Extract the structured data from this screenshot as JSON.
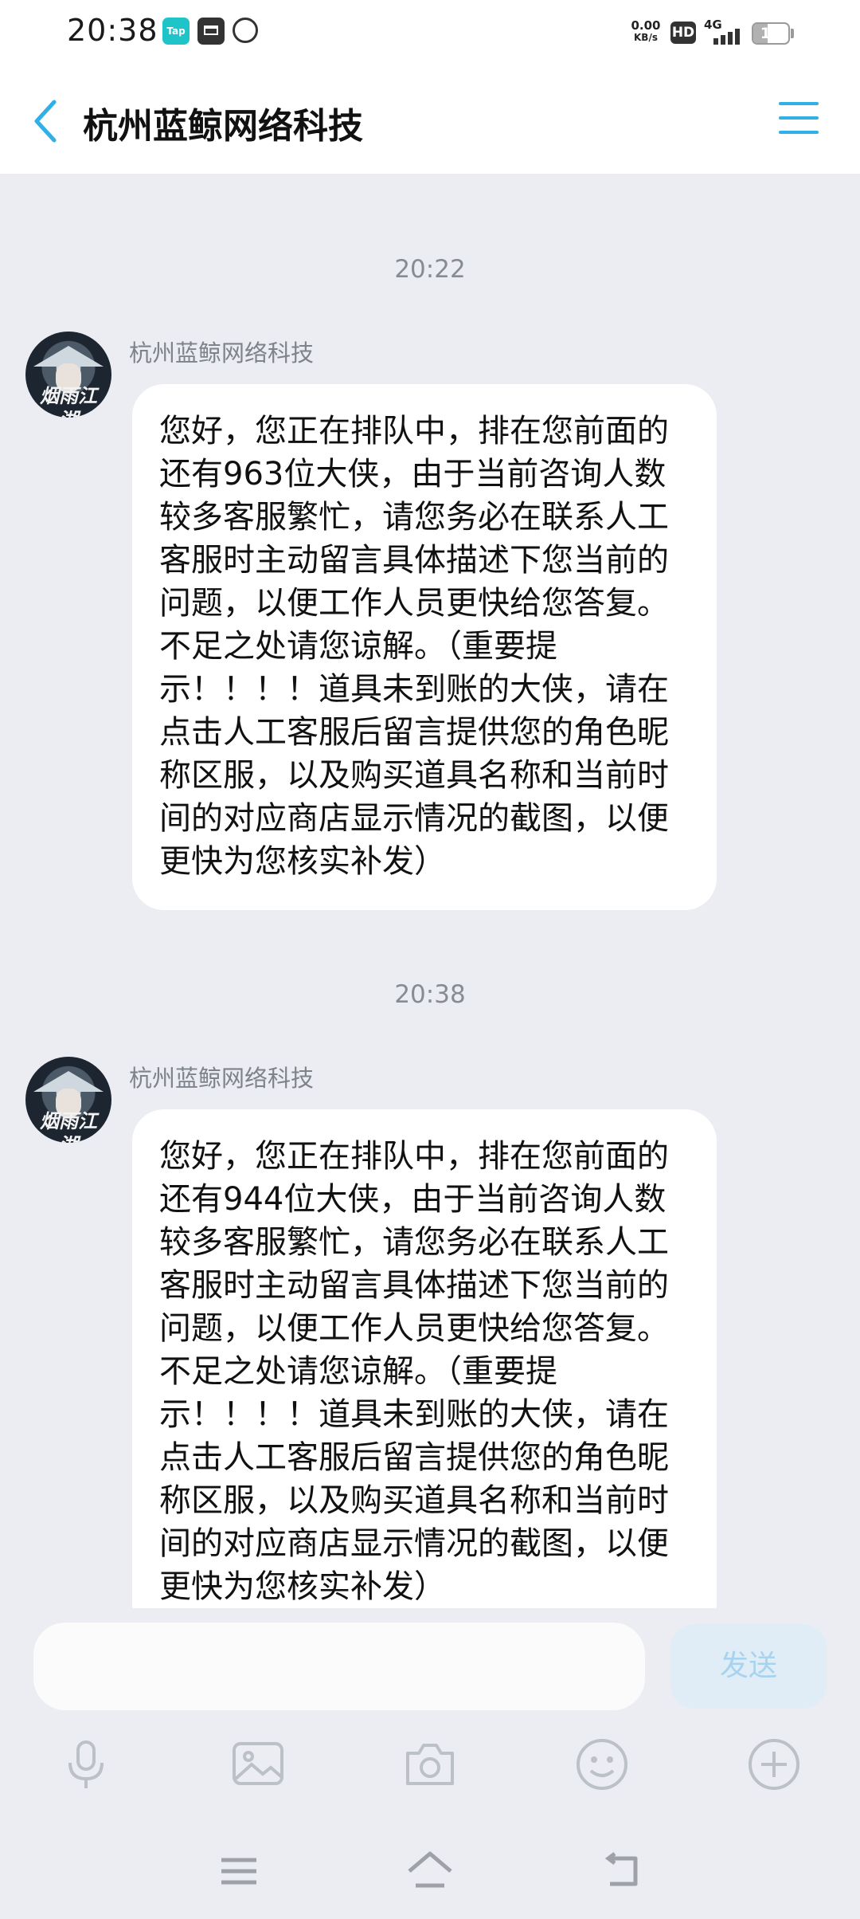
{
  "status_bar": {
    "time": "20:38",
    "app_icon_label": "Tap",
    "net_speed_value": "0.00",
    "net_speed_unit": "KB/s",
    "hd_label": "HD",
    "network": "4G",
    "battery_level": "10"
  },
  "header": {
    "title": "杭州蓝鲸网络科技",
    "back_icon": "chevron-left-icon",
    "menu_icon": "hamburger-menu-icon",
    "accent_color": "#2fb1e8"
  },
  "chat": {
    "messages": [
      {
        "timestamp": "20:22",
        "sender": "杭州蓝鲸网络科技",
        "avatar_text": "烟雨江湖",
        "text": "您好，您正在排队中，排在您前面的还有963位大侠，由于当前咨询人数较多客服繁忙，请您务必在联系人工客服时主动留言具体描述下您当前的问题，以便工作人员更快给您答复。不足之处请您谅解。（重要提示！！！！道具未到账的大侠，请在点击人工客服后留言提供您的角色昵称区服，以及购买道具名称和当前时间的对应商店显示情况的截图，以便更快为您核实补发）"
      },
      {
        "timestamp": "20:38",
        "sender": "杭州蓝鲸网络科技",
        "avatar_text": "烟雨江湖",
        "text": "您好，您正在排队中，排在您前面的还有944位大侠，由于当前咨询人数较多客服繁忙，请您务必在联系人工客服时主动留言具体描述下您当前的问题，以便工作人员更快给您答复。不足之处请您谅解。（重要提示！！！！道具未到账的大侠，请在点击人工客服后留言提供您的角色昵称区服，以及购买道具名称和当前时间的对应商店显示情况的截图，以便更快为您核实补发）"
      }
    ]
  },
  "composer": {
    "input_value": "",
    "send_label": "发送",
    "tools": [
      "microphone-icon",
      "image-icon",
      "camera-icon",
      "emoji-icon",
      "plus-icon"
    ]
  },
  "nav_bar": {
    "buttons": [
      "menu-icon",
      "home-icon",
      "back-icon"
    ]
  }
}
